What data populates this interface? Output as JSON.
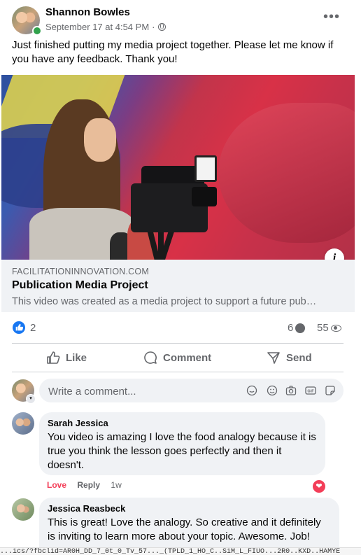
{
  "post": {
    "author": "Shannon Bowles",
    "timestamp": "September 17 at 4:54 PM",
    "separator": "·",
    "audience_icon": "globe-icon",
    "more_icon": "•••",
    "text": "Just finished putting my media project together. Please let me know if you have any feedback. Thank you!"
  },
  "link_preview": {
    "domain": "FACILITATIONINNOVATION.COM",
    "title": "Publication Media Project",
    "description": "This video was created as a media project to support a future pub…",
    "info_icon": "i"
  },
  "stats": {
    "likes": "2",
    "comments": "6",
    "views": "55"
  },
  "actions": {
    "like": "Like",
    "comment": "Comment",
    "send": "Send"
  },
  "composer": {
    "placeholder": "Write a comment..."
  },
  "comments": [
    {
      "name": "Sarah Jessica",
      "text": "You video is amazing I love the food analogy because it is true you think the lesson goes perfectly and then it doesn't.",
      "love": "Love",
      "reply": "Reply",
      "time": "1w"
    },
    {
      "name": "Jessica Reasbeck",
      "text": "This is great! Love the analogy. So creative and it definitely is inviting to learn more about your topic. Awesome. Job!"
    }
  ],
  "status_url": "...ics/?fbclid=AR0H_DD_7_0t_0_Tv_57..._(TPLD_1_HO_C..SiM_L_FIUO...2R0..KXD..HAMYE",
  "colors": {
    "accent": "#1877f2",
    "love": "#f33e58",
    "secondary_text": "#65676b"
  }
}
